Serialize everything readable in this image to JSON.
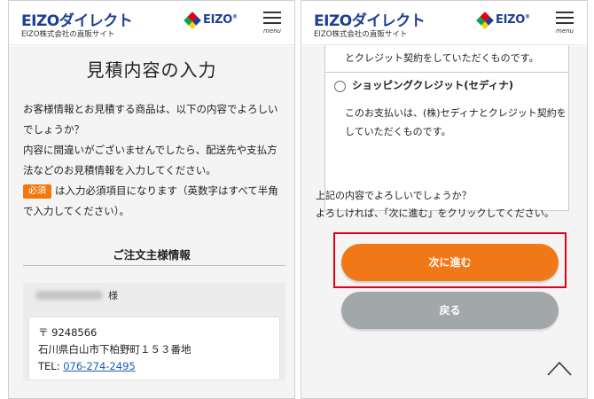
{
  "header": {
    "brand": "EIZOダイレクト",
    "brand_sub": "EIZO株式会社の直販サイト",
    "logo_text": "EIZO",
    "logo_reg": "®",
    "menu_label": "menu"
  },
  "left": {
    "page_title": "見積内容の入力",
    "intro_lines": [
      "お客様情報とお見積する商品は、以下の内容でよろしい",
      "でしょうか？",
      "内容に間違いがございませんでしたら、配送先や支払方",
      "法などのお見積情報を入力してください。"
    ],
    "required_badge": "必須",
    "required_note_line1": "は入力必須項目になります（英数字はすべて半角",
    "required_note_line2": "で入力してください）。",
    "section_title": "ご注文主様情報",
    "customer_suffix": "様",
    "postal": "〒 9248566",
    "address": "石川県白山市下柏野町１５３番地",
    "tel_label": "TEL: ",
    "tel": "076-274-2495"
  },
  "right": {
    "pay_top_text": "とクレジット契約をしていただくものです。",
    "option_label": "ショッピングクレジット(セディナ)",
    "option_desc_line1": "このお支払いは、(株)セディナとクレジット契約を",
    "option_desc_line2": "していただくものです。",
    "confirm_line1": "上記の内容でよろしいでしょうか？",
    "confirm_line2": "よろしければ、「次に進む」をクリックしてください。",
    "next_button": "次に進む",
    "back_button": "戻る"
  },
  "colors": {
    "brand_blue": "#1c3f95",
    "accent_orange": "#f07816",
    "highlight_red": "#e0001b",
    "back_gray": "#a2a7aa",
    "link_blue": "#1a5dbb"
  },
  "icons": [
    "menu-icon",
    "eizo-logo-icon",
    "radio-icon",
    "page-top-chevron-icon"
  ]
}
